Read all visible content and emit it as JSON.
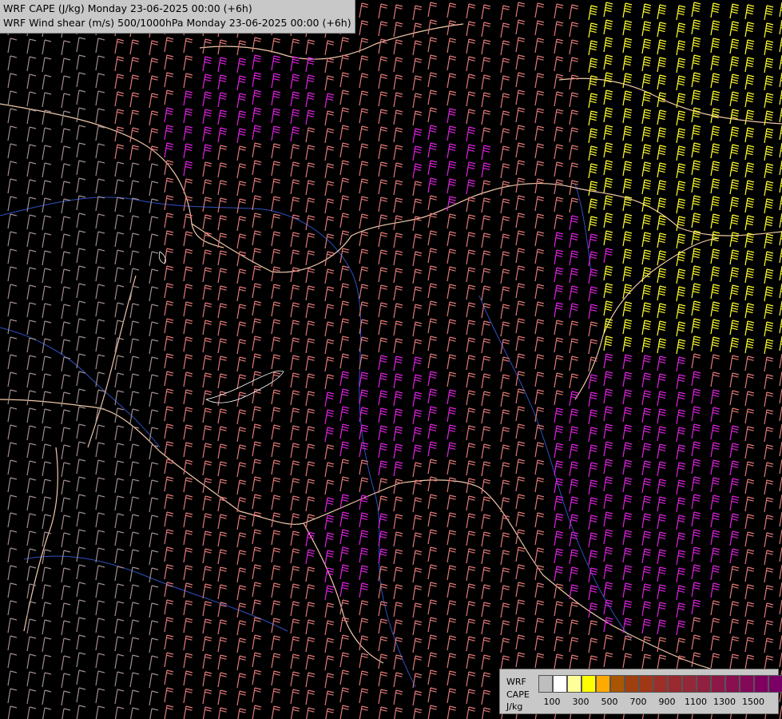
{
  "header": {
    "line1": "WRF CAPE (J/kg) Monday 23-06-2025 00:00 (+6h)",
    "line2": "WRF Wind shear (m/s) 500/1000hPa Monday 23-06-2025 00:00 (+6h)"
  },
  "legend": {
    "label_model": "WRF",
    "label_param": "CAPE",
    "label_unit": "J/kg",
    "colors": [
      "#bebebe",
      "#ffffff",
      "#ffff99",
      "#ffff00",
      "#ffaa00",
      "#aa5500",
      "#a04010",
      "#a03818",
      "#9c3028",
      "#982a30",
      "#942838",
      "#902040",
      "#8c1848",
      "#881050",
      "#840858",
      "#800060",
      "#7a0068"
    ],
    "ticks": [
      "100",
      "300",
      "500",
      "700",
      "900",
      "1100",
      "1300",
      "1500"
    ]
  },
  "map_colors": {
    "background": "#000000",
    "borders": "#f0c8a8",
    "rivers": "#3050c0",
    "barb_low": "#a08c8c",
    "barb_mid": "#e07878",
    "barb_high": "#e020e0",
    "barb_max": "#ffff30"
  }
}
